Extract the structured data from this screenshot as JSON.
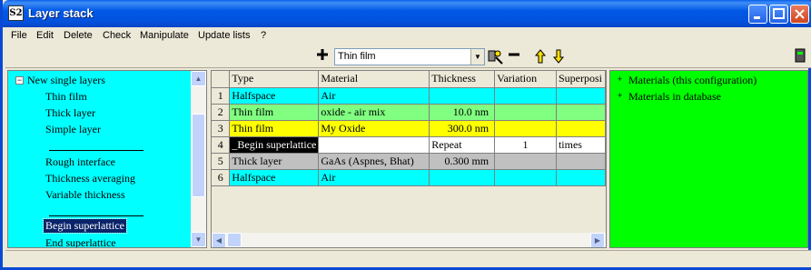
{
  "window": {
    "title": "Layer stack",
    "app_icon_text": "S2",
    "border_color": "#0a49d6"
  },
  "menu": [
    "File",
    "Edit",
    "Delete",
    "Check",
    "Manipulate",
    "Update lists",
    "?"
  ],
  "toolbar": {
    "selected_layer_type": "Thin film",
    "icons": [
      "plus-icon",
      "dropdown-arrow-icon",
      "wizard-icon",
      "minus-icon",
      "arrow-up-icon",
      "arrow-down-icon",
      "device-icon"
    ]
  },
  "left_tree": {
    "background": "#00ffff",
    "root_label": "New single layers",
    "group1": [
      "Thin film",
      "Thick layer",
      "Simple layer"
    ],
    "group2": [
      "Rough interface",
      "Thickness averaging",
      "Variable thickness"
    ],
    "group3": [
      "Begin superlattice",
      "End superlattice"
    ],
    "selected": "Begin superlattice"
  },
  "grid": {
    "headers": [
      "",
      "Type",
      "Material",
      "Thickness",
      "Variation",
      "Superposi"
    ],
    "rows": [
      {
        "num": "1",
        "type": "Halfspace",
        "material": "Air",
        "thickness": "",
        "variation": "",
        "superpos": "",
        "color": "#00ffff"
      },
      {
        "num": "2",
        "type": "Thin film",
        "material": "oxide - air mix",
        "thickness": "10.0 nm",
        "variation": "",
        "superpos": "",
        "color": "#80ff80"
      },
      {
        "num": "3",
        "type": "Thin film",
        "material": "My Oxide",
        "thickness": "300.0 nm",
        "variation": "",
        "superpos": "",
        "color": "#ffff00"
      },
      {
        "num": "4",
        "type": "_Begin superlattice",
        "material": "",
        "thickness": "Repeat",
        "variation": "1",
        "superpos": "times",
        "color": "#ffffff"
      },
      {
        "num": "5",
        "type": "Thick layer",
        "material": "GaAs (Aspnes, Bhat)",
        "thickness": "0.300 mm",
        "variation": "",
        "superpos": "",
        "color": "#c0c0c0"
      },
      {
        "num": "6",
        "type": "Halfspace",
        "material": "Air",
        "thickness": "",
        "variation": "",
        "superpos": "",
        "color": "#00ffff"
      }
    ]
  },
  "right_tree": {
    "background": "#00ff00",
    "items": [
      "Materials (this configuration)",
      "Materials in database"
    ]
  }
}
